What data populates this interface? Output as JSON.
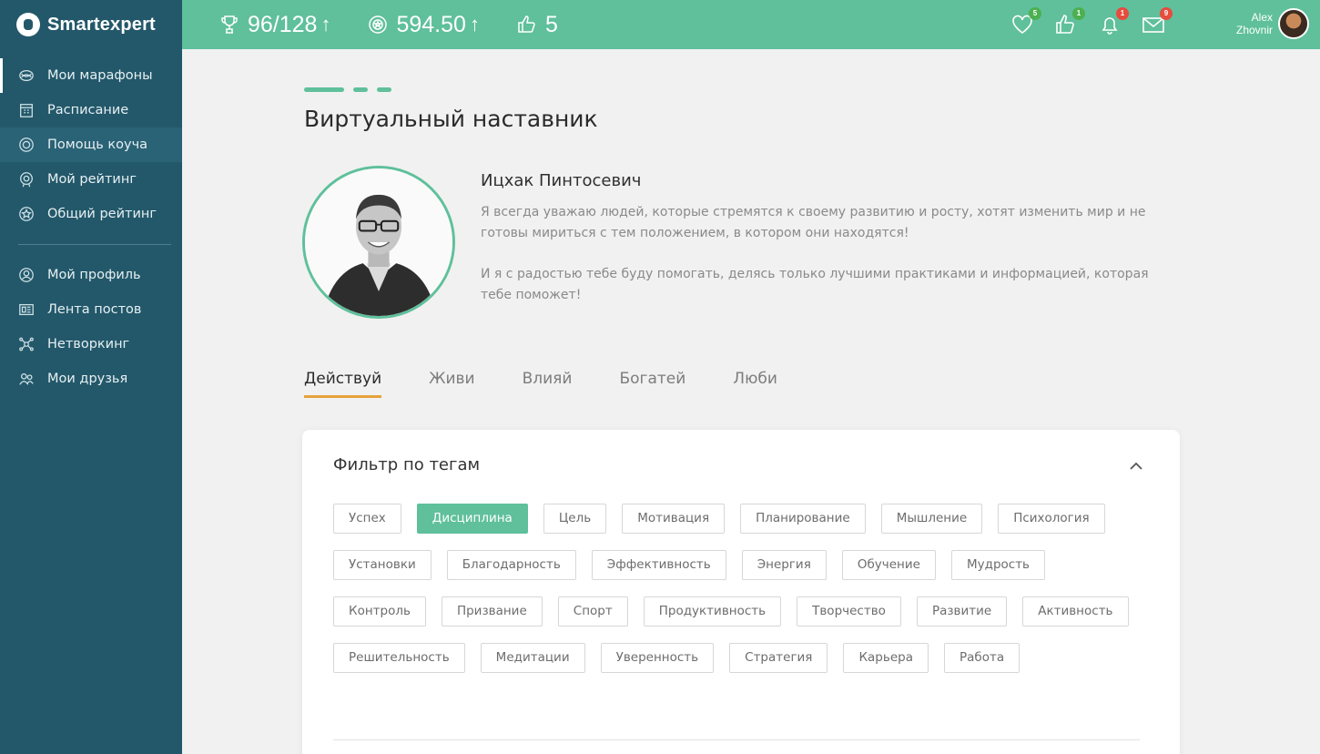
{
  "brand": {
    "name": "Smartexpert"
  },
  "sidebar": {
    "items": [
      {
        "label": "Мои марафоны",
        "icon": "marathon-icon"
      },
      {
        "label": "Расписание",
        "icon": "calendar-icon"
      },
      {
        "label": "Помощь коуча",
        "icon": "lifebuoy-icon"
      },
      {
        "label": "Мой рейтинг",
        "icon": "medal-icon"
      },
      {
        "label": "Общий рейтинг",
        "icon": "star-badge-icon"
      },
      {
        "label": "Мой профиль",
        "icon": "profile-icon"
      },
      {
        "label": "Лента постов",
        "icon": "feed-icon"
      },
      {
        "label": "Нетворкинг",
        "icon": "network-icon"
      },
      {
        "label": "Мои друзья",
        "icon": "friends-icon"
      }
    ],
    "active_index": 2
  },
  "topbar": {
    "trophy": {
      "value": "96/128",
      "arrow": "↑"
    },
    "points": {
      "value": "594.50",
      "arrow": "↑"
    },
    "likes": {
      "value": "5"
    },
    "notifications": [
      {
        "icon": "heart-icon",
        "badge": "5",
        "badge_color": "#4caf50"
      },
      {
        "icon": "thumbs-up-icon",
        "badge": "1",
        "badge_color": "#4caf50"
      },
      {
        "icon": "bell-icon",
        "badge": "1",
        "badge_color": "#e74c3c"
      },
      {
        "icon": "envelope-icon",
        "badge": "9",
        "badge_color": "#e74c3c"
      }
    ],
    "user": {
      "first_name": "Alex",
      "last_name": "Zhovnir"
    }
  },
  "main": {
    "title": "Виртуальный наставник",
    "mentor": {
      "name": "Ицхак Пинтосевич",
      "paragraph1": "Я всегда уважаю людей, которые стремятся к своему развитию и росту, хотят изменить мир и не готовы мириться с тем положением, в котором они находятся!",
      "paragraph2": "И я с радостью тебе буду помогать, делясь только лучшими практиками и информацией, которая тебе поможет!"
    },
    "tabs": [
      "Действуй",
      "Живи",
      "Влияй",
      "Богатей",
      "Люби"
    ],
    "active_tab": 0,
    "filter": {
      "title": "Фильтр по тегам",
      "tags": [
        "Успех",
        "Дисциплина",
        "Цель",
        "Мотивация",
        "Планирование",
        "Мышление",
        "Психология",
        "Установки",
        "Благодарность",
        "Эффективность",
        "Энергия",
        "Обучение",
        "Мудрость",
        "Контроль",
        "Призвание",
        "Спорт",
        "Продуктивность",
        "Творчество",
        "Развитие",
        "Активность",
        "Решительность",
        "Медитации",
        "Уверенность",
        "Стратегия",
        "Карьера",
        "Работа"
      ],
      "selected_tag": "Дисциплина"
    }
  },
  "colors": {
    "accent": "#5fc09b",
    "sidebar": "#23586a",
    "tab_underline": "#e6a23c"
  }
}
